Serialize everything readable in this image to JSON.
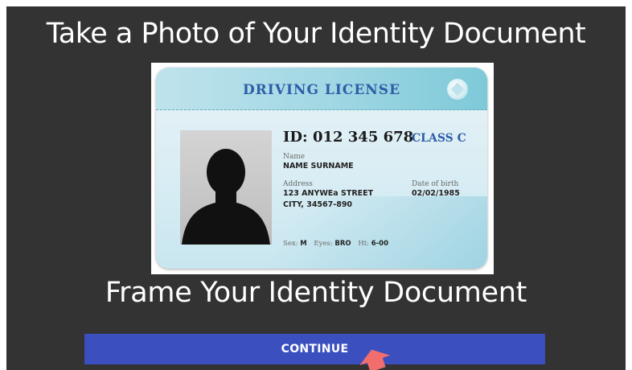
{
  "heading_top": "Take a Photo of Your Identity Document",
  "heading_bottom": "Frame Your Identity Document",
  "card": {
    "title": "DRIVING LICENSE",
    "id_number": "ID: 012 345 678",
    "class_label": "CLASS C",
    "name_label": "Name",
    "name_value": "NAME SURNAME",
    "address_label": "Address",
    "address_line1": "123 ANYWEa STREET",
    "address_line2": "CITY, 34567-890",
    "dob_label": "Date of birth",
    "dob_value": "02/02/1985",
    "sex_label": "Sex:",
    "sex_value": "M",
    "eyes_label": "Eyes:",
    "eyes_value": "BRO",
    "height_label": "Ht:",
    "height_value": "6-00"
  },
  "continue_button": {
    "label": "CONTINUE"
  },
  "colors": {
    "background": "#333333",
    "button": "#3b4fbf",
    "card_title": "#2e5da8",
    "pointer": "#f26d6d"
  },
  "icons": {
    "photo": "person-silhouette-icon",
    "seal": "card-seal-icon",
    "pointer": "cursor-arrow-icon"
  }
}
